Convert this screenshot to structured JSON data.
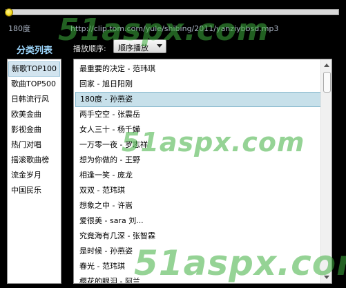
{
  "player": {
    "progress": 0.0,
    "status_prefix": "180度",
    "url": "http://clip.tom.com/yule/shibing/2011/yanziybbsd.mp3"
  },
  "sidebar": {
    "title": "分类列表",
    "items": [
      {
        "label": "新歌TOP100",
        "selected": true
      },
      {
        "label": "歌曲TOP500"
      },
      {
        "label": "日韩流行风"
      },
      {
        "label": "欧美金曲"
      },
      {
        "label": "影视金曲"
      },
      {
        "label": "热门对唱"
      },
      {
        "label": "摇滚歌曲榜"
      },
      {
        "label": "流金岁月"
      },
      {
        "label": "中国民乐"
      }
    ]
  },
  "order": {
    "label": "播放顺序:",
    "selected": "顺序播放"
  },
  "songs": [
    {
      "label": "最重要的决定 - 范玮琪"
    },
    {
      "label": "回家 - 旭日阳刚"
    },
    {
      "label": "180度 - 孙燕姿",
      "selected": true
    },
    {
      "label": "两手空空 - 张震岳"
    },
    {
      "label": "女人三十 - 杨千嬅"
    },
    {
      "label": "一万零一夜 - 罗志祥"
    },
    {
      "label": "想为你做的 - 王野"
    },
    {
      "label": "相逢一笑 - 庞龙"
    },
    {
      "label": "双双 - 范玮琪"
    },
    {
      "label": "想象之中 - 许嵩"
    },
    {
      "label": "爱很美 - sara 刘..."
    },
    {
      "label": "究竟海有几深 - 张智霖"
    },
    {
      "label": "是时候 - 孙燕姿"
    },
    {
      "label": "春光 - 范玮琪"
    },
    {
      "label": "樱花的眼泪 - 阿兰"
    }
  ],
  "watermark": {
    "text": "51aspx.com",
    "color": "#3eae3e"
  },
  "colors": {
    "background": "#000000",
    "sidebar_title": "#9fd9ff",
    "selection": "#c7e0ea"
  }
}
